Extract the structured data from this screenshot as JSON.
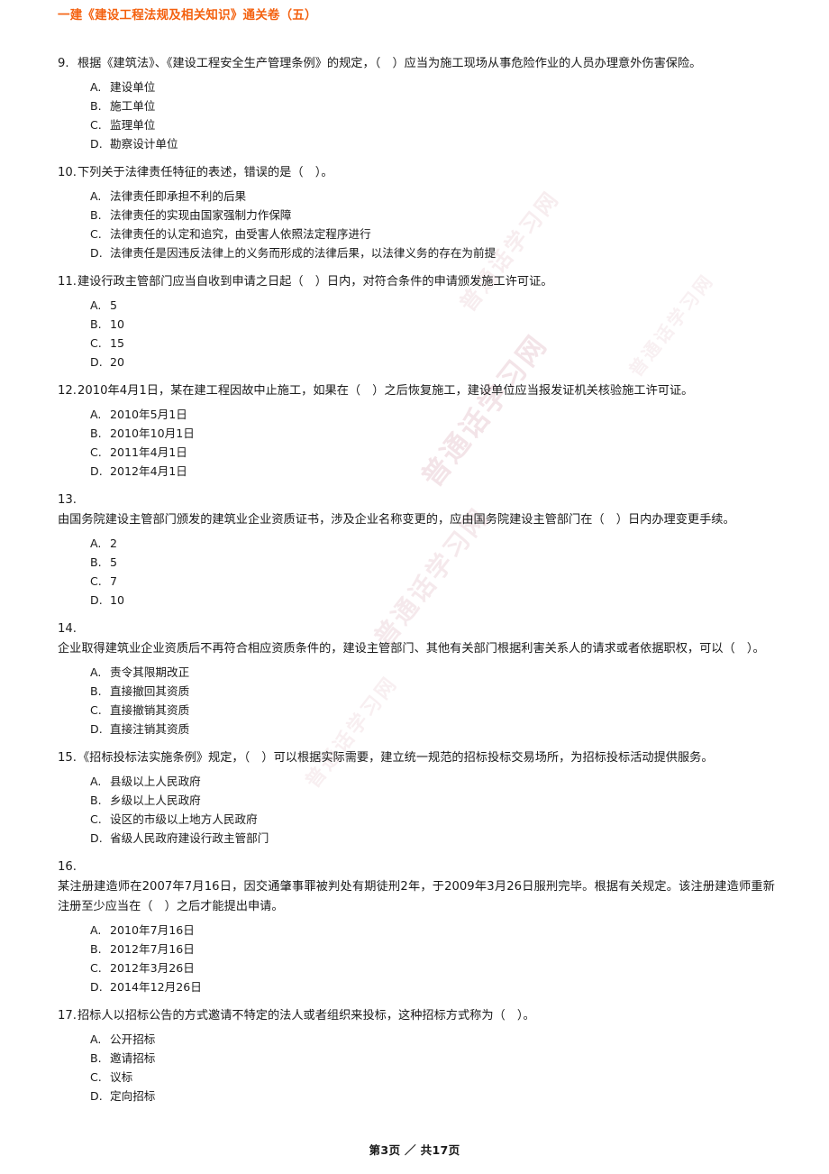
{
  "document": {
    "header_title": "一建《建设工程法规及相关知识》通关卷（五）",
    "header_color": "#f4610f",
    "footer_text": "第3页 ／ 共17页",
    "page_number": 3,
    "total_pages": 17
  },
  "watermark": {
    "text": "普通话学习网",
    "color": "#d9a8b4"
  },
  "questions": [
    {
      "number": "9.",
      "number_standalone": false,
      "stem": "根据《建筑法》、《建设工程安全生产管理条例》的规定，（　）应当为施工现场从事危险作业的人员办理意外伤害保险。",
      "options": [
        {
          "letter": "A.",
          "text": "建设单位"
        },
        {
          "letter": "B.",
          "text": "施工单位"
        },
        {
          "letter": "C.",
          "text": "监理单位"
        },
        {
          "letter": "D.",
          "text": "勘察设计单位"
        }
      ]
    },
    {
      "number": "10.",
      "number_standalone": false,
      "stem": "下列关于法律责任特征的表述，错误的是（　）。",
      "options": [
        {
          "letter": "A.",
          "text": "法律责任即承担不利的后果"
        },
        {
          "letter": "B.",
          "text": "法律责任的实现由国家强制力作保障"
        },
        {
          "letter": "C.",
          "text": "法律责任的认定和追究，由受害人依照法定程序进行"
        },
        {
          "letter": "D.",
          "text": "法律责任是因违反法律上的义务而形成的法律后果，以法律义务的存在为前提"
        }
      ]
    },
    {
      "number": "11.",
      "number_standalone": false,
      "stem": "建设行政主管部门应当自收到申请之日起（　）日内，对符合条件的申请颁发施工许可证。",
      "options": [
        {
          "letter": "A.",
          "text": "5"
        },
        {
          "letter": "B.",
          "text": "10"
        },
        {
          "letter": "C.",
          "text": "15"
        },
        {
          "letter": "D.",
          "text": "20"
        }
      ]
    },
    {
      "number": "12.",
      "number_standalone": false,
      "stem": "2010年4月1日，某在建工程因故中止施工，如果在（　）之后恢复施工，建设单位应当报发证机关核验施工许可证。",
      "options": [
        {
          "letter": "A.",
          "text": "2010年5月1日"
        },
        {
          "letter": "B.",
          "text": "2010年10月1日"
        },
        {
          "letter": "C.",
          "text": "2011年4月1日"
        },
        {
          "letter": "D.",
          "text": "2012年4月1日"
        }
      ]
    },
    {
      "number": "13.",
      "number_standalone": true,
      "stem": "由国务院建设主管部门颁发的建筑业企业资质证书，涉及企业名称变更的，应由国务院建设主管部门在（　）日内办理变更手续。",
      "options": [
        {
          "letter": "A.",
          "text": "2"
        },
        {
          "letter": "B.",
          "text": "5"
        },
        {
          "letter": "C.",
          "text": "7"
        },
        {
          "letter": "D.",
          "text": "10"
        }
      ]
    },
    {
      "number": "14.",
      "number_standalone": true,
      "stem": "企业取得建筑业企业资质后不再符合相应资质条件的，建设主管部门、其他有关部门根据利害关系人的请求或者依据职权，可以（　）。",
      "options": [
        {
          "letter": "A.",
          "text": "责令其限期改正"
        },
        {
          "letter": "B.",
          "text": "直接撤回其资质"
        },
        {
          "letter": "C.",
          "text": "直接撤销其资质"
        },
        {
          "letter": "D.",
          "text": "直接注销其资质"
        }
      ]
    },
    {
      "number": "15.",
      "number_standalone": false,
      "stem": "《招标投标法实施条例》规定，（　）可以根据实际需要，建立统一规范的招标投标交易场所，为招标投标活动提供服务。",
      "options": [
        {
          "letter": "A.",
          "text": "县级以上人民政府"
        },
        {
          "letter": "B.",
          "text": "乡级以上人民政府"
        },
        {
          "letter": "C.",
          "text": "设区的市级以上地方人民政府"
        },
        {
          "letter": "D.",
          "text": "省级人民政府建设行政主管部门"
        }
      ]
    },
    {
      "number": "16.",
      "number_standalone": true,
      "stem": "某注册建造师在2007年7月16日，因交通肇事罪被判处有期徒刑2年，于2009年3月26日服刑完毕。根据有关规定。该注册建造师重新注册至少应当在（　）之后才能提出申请。",
      "options": [
        {
          "letter": "A.",
          "text": "2010年7月16日"
        },
        {
          "letter": "B.",
          "text": "2012年7月16日"
        },
        {
          "letter": "C.",
          "text": "2012年3月26日"
        },
        {
          "letter": "D.",
          "text": "2014年12月26日"
        }
      ]
    },
    {
      "number": "17.",
      "number_standalone": false,
      "stem": "招标人以招标公告的方式邀请不特定的法人或者组织来投标，这种招标方式称为（　）。",
      "options": [
        {
          "letter": "A.",
          "text": "公开招标"
        },
        {
          "letter": "B.",
          "text": "邀请招标"
        },
        {
          "letter": "C.",
          "text": "议标"
        },
        {
          "letter": "D.",
          "text": "定向招标"
        }
      ]
    }
  ]
}
